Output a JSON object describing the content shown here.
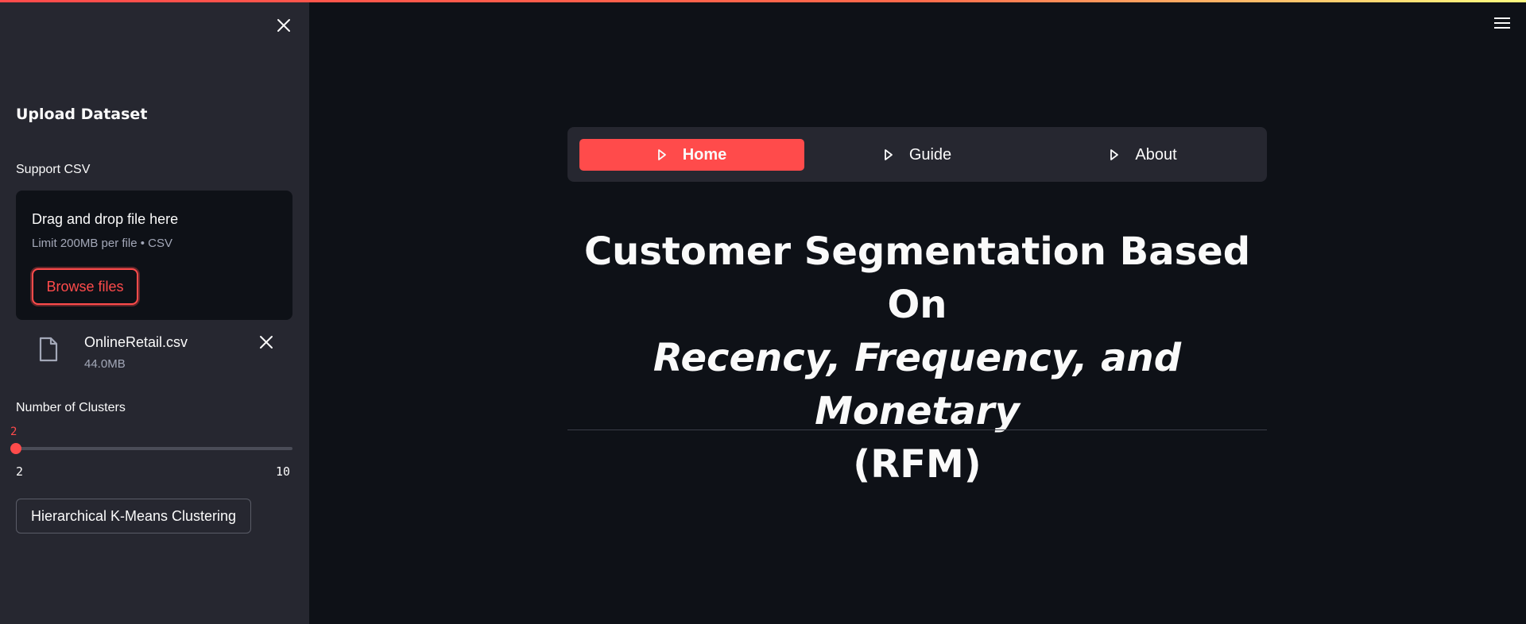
{
  "sidebar": {
    "heading": "Upload Dataset",
    "uploader": {
      "label": "Support CSV",
      "drop_title": "Drag and drop file here",
      "limit_text": "Limit 200MB per file • CSV",
      "browse_label": "Browse files",
      "file": {
        "name": "OnlineRetail.csv",
        "size": "44.0MB"
      }
    },
    "slider": {
      "label": "Number of Clusters",
      "value": "2",
      "min": "2",
      "max": "10"
    },
    "cluster_button": "Hierarchical K-Means Clustering"
  },
  "nav": {
    "items": [
      {
        "label": "Home",
        "active": true
      },
      {
        "label": "Guide",
        "active": false
      },
      {
        "label": "About",
        "active": false
      }
    ]
  },
  "main": {
    "title_line1": "Customer Segmentation Based On",
    "title_line2": "Recency, Frequency, and Monetary",
    "title_line3": "(RFM)"
  },
  "colors": {
    "accent": "#ff4b4b",
    "sidebar_bg": "#262730",
    "main_bg": "#0e1117"
  }
}
